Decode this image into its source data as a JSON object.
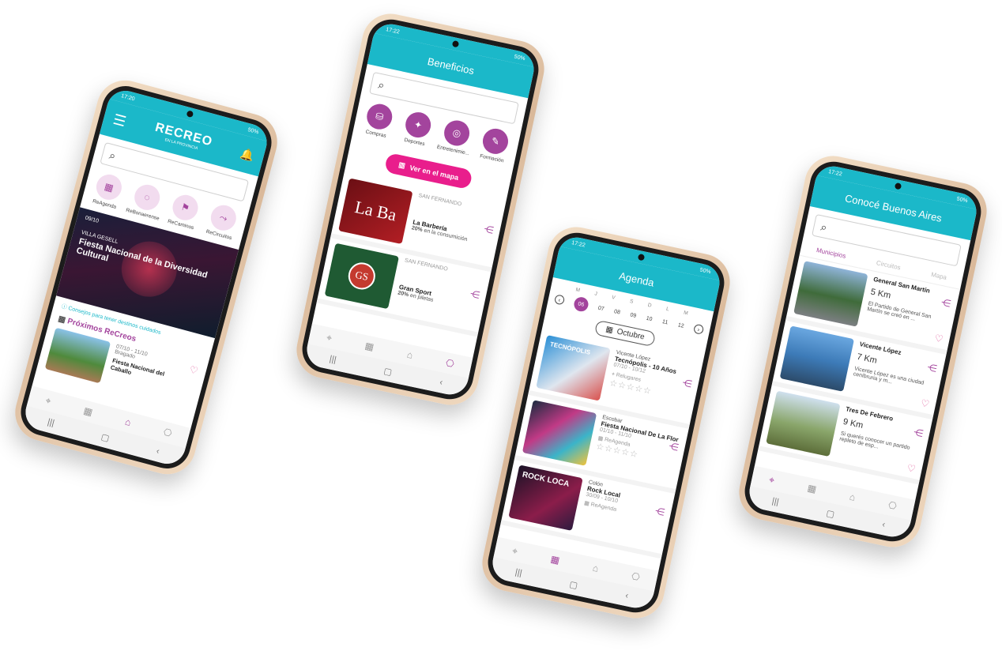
{
  "phone1": {
    "status_time": "17:20",
    "status_right": "50%",
    "logo_text": "RECREO",
    "logo_sub": "EN LA PROVINCIA",
    "categories": [
      {
        "label": "ReAgenda",
        "icon": "calendar-icon"
      },
      {
        "label": "ReBonaerense",
        "icon": "chat-icon"
      },
      {
        "label": "ReCaminos",
        "icon": "signpost-icon"
      },
      {
        "label": "ReCircuitos",
        "icon": "route-icon"
      }
    ],
    "banner_date": "09/10",
    "banner_place": "VILLA GESELL",
    "banner_title": "Fiesta Nacional de la Diversidad Cultural",
    "tips_link": "Consejos para tener destinos cuidados",
    "section_title": "Próximos ReCreos",
    "event_dates": "07/10 - 11/10",
    "event_place": "Bragado",
    "event_title": "Fiesta Nacional del Caballo"
  },
  "phone2": {
    "status_time": "17:22",
    "status_right": "50%",
    "title": "Beneficios",
    "categories": [
      {
        "label": "Compras",
        "icon": "shopping-icon"
      },
      {
        "label": "Deportes",
        "icon": "sports-icon"
      },
      {
        "label": "Entretenimie...",
        "icon": "entertainment-icon"
      },
      {
        "label": "Formación",
        "icon": "education-icon"
      }
    ],
    "map_button": "Ver en el mapa",
    "items": [
      {
        "place": "SAN FERNANDO",
        "title": "La Barbería",
        "discount": "20%",
        "discount_text": "en la consumición",
        "thumb_text": "La Ba"
      },
      {
        "place": "SAN FERNANDO",
        "title": "Gran Sport",
        "discount": "20%",
        "discount_text": "en piletas",
        "thumb_text": "GS"
      }
    ]
  },
  "phone3": {
    "status_time": "17:22",
    "status_right": "50%",
    "title": "Agenda",
    "weekdays": [
      "M",
      "J",
      "V",
      "S",
      "D",
      "L",
      "M"
    ],
    "days": [
      "06",
      "07",
      "08",
      "09",
      "10",
      "11",
      "12"
    ],
    "month": "Octubre",
    "events": [
      {
        "place": "Vicente López",
        "title": "Tecnópolis - 10 Años",
        "dates": "07/10 - 10/12",
        "tag": "Relugares",
        "thumb_text": "TECNÓPOLIS"
      },
      {
        "place": "Escobar",
        "title": "Fiesta Nacional De La Flor",
        "dates": "01/10 - 11/10",
        "tag": "ReAgenda",
        "thumb_text": ""
      },
      {
        "place": "Colón",
        "title": "Rock Local",
        "dates": "30/09 - 10/10",
        "tag": "ReAgenda",
        "thumb_text": "ROCK LOCA"
      }
    ]
  },
  "phone4": {
    "status_time": "17:22",
    "status_right": "50%",
    "title": "Conocé Buenos Aires",
    "tabs": [
      "Municipios",
      "Circuitos",
      "Mapa"
    ],
    "items": [
      {
        "title": "General San Martín",
        "distance": "5 Km",
        "desc": "El Partido de General San Martín se creó en ..."
      },
      {
        "title": "Vicente López",
        "distance": "7 Km",
        "desc": "Vicente López es una ciudad ceníbruria y m..."
      },
      {
        "title": "Tres De Febrero",
        "distance": "9 Km",
        "desc": "Si querés conocer un partido repleto de esp..."
      }
    ]
  },
  "colors": {
    "teal": "#1bb8c9",
    "purple": "#a3449d",
    "magenta": "#e91e8c",
    "frame_gold": "#d9b899"
  }
}
